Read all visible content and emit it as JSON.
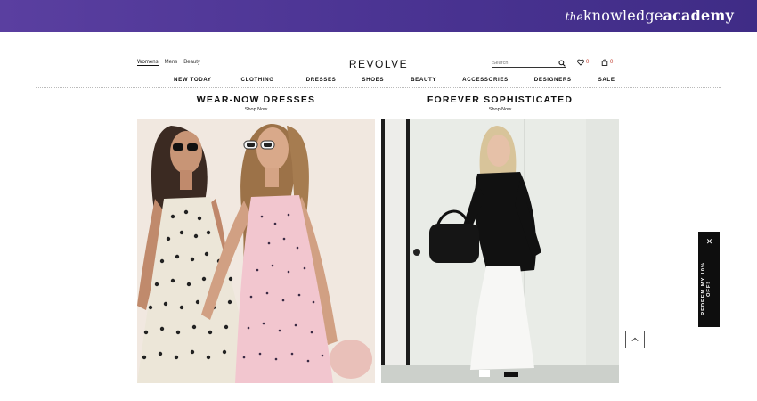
{
  "banner": {
    "logo_the": "the",
    "logo_part1": "knowledge",
    "logo_part2": "academy"
  },
  "header": {
    "gender_tabs": [
      "Womens",
      "Mens",
      "Beauty"
    ],
    "brand": "REVOLVE",
    "search_placeholder": "Search",
    "wishlist_count": "0",
    "bag_count": "0"
  },
  "nav": [
    "NEW TODAY",
    "CLOTHING",
    "DRESSES",
    "SHOES",
    "BEAUTY",
    "ACCESSORIES",
    "DESIGNERS",
    "SALE"
  ],
  "promos": [
    {
      "title": "WEAR-NOW DRESSES",
      "link": "Shop Now"
    },
    {
      "title": "FOREVER SOPHISTICATED",
      "link": "Shop Now"
    }
  ],
  "redeem": {
    "label": "REDEEM MY 10% OFF!",
    "close": "✕"
  },
  "colors": {
    "banner": "#4b3493",
    "accent_count": "#c0392b",
    "redeem_bg": "#0e0e0e"
  }
}
